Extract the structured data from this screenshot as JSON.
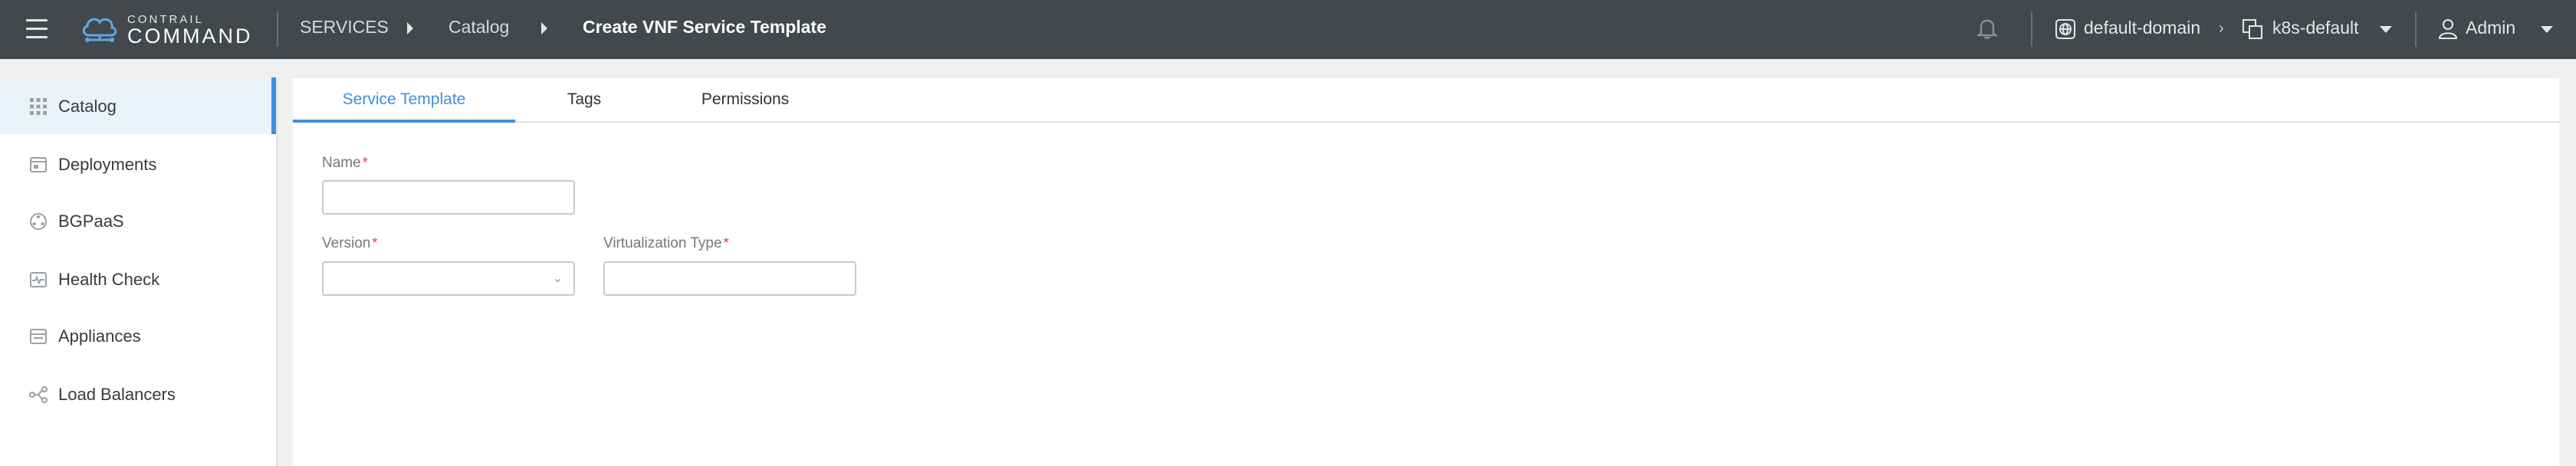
{
  "brand": {
    "line1": "CONTRAIL",
    "line2": "COMMAND"
  },
  "breadcrumb": {
    "section": "SERVICES",
    "parent": "Catalog",
    "current": "Create VNF Service Template"
  },
  "topbar": {
    "domain": "default-domain",
    "project": "k8s-default",
    "user": "Admin"
  },
  "sidebar": {
    "items": [
      {
        "label": "Catalog",
        "icon": "grid-icon",
        "active": true
      },
      {
        "label": "Deployments",
        "icon": "deployments-icon"
      },
      {
        "label": "BGPaaS",
        "icon": "bgpaas-icon"
      },
      {
        "label": "Health Check",
        "icon": "health-check-icon"
      },
      {
        "label": "Appliances",
        "icon": "appliances-icon"
      },
      {
        "label": "Load Balancers",
        "icon": "load-balancer-icon"
      }
    ]
  },
  "tabs": [
    {
      "label": "Service Template",
      "active": true
    },
    {
      "label": "Tags"
    },
    {
      "label": "Permissions"
    }
  ],
  "form": {
    "name": {
      "label": "Name",
      "required": "*",
      "value": ""
    },
    "version": {
      "label": "Version",
      "required": "*",
      "value": ""
    },
    "virtualization_type": {
      "label": "Virtualization Type",
      "required": "*",
      "value": ""
    }
  },
  "colors": {
    "topbar": "#44484d",
    "accent": "#3d8fe0",
    "required": "#e03c3c"
  }
}
